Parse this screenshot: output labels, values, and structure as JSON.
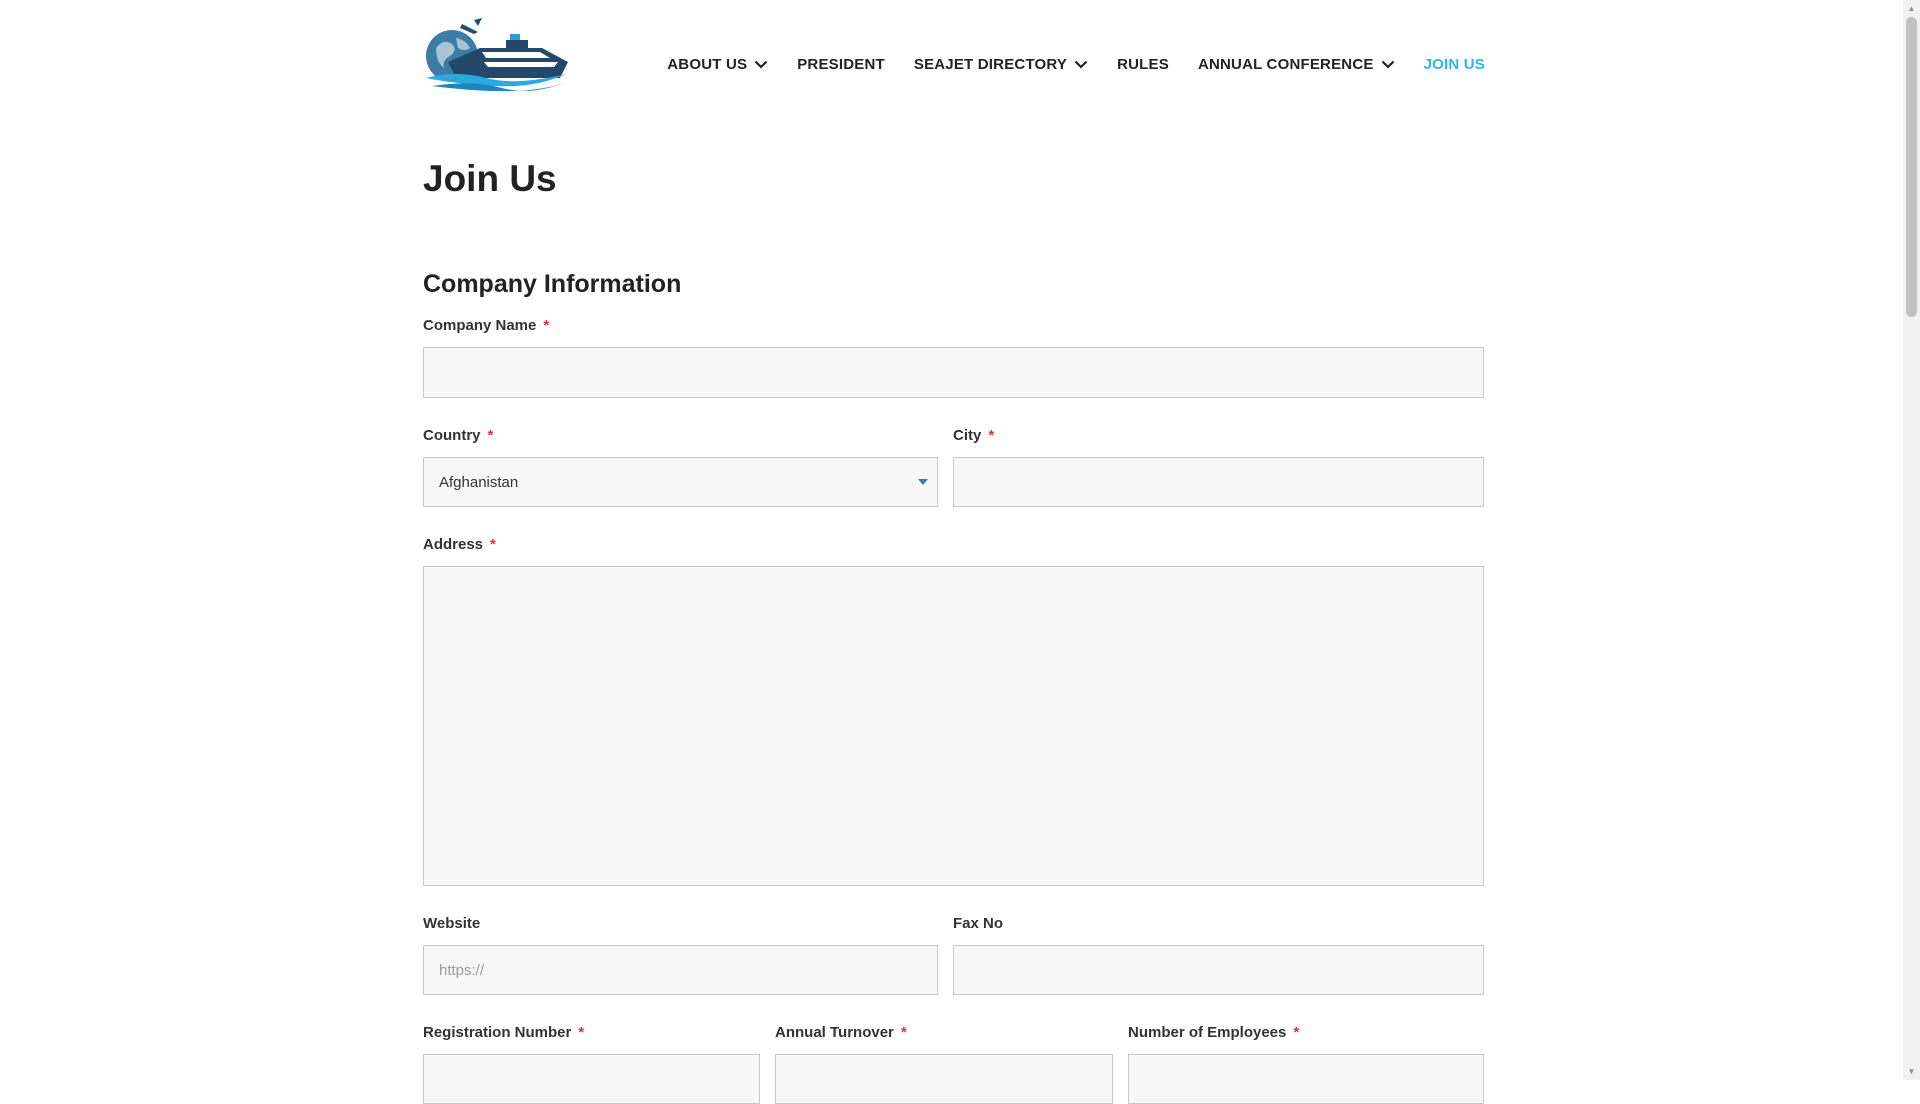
{
  "nav": {
    "items": [
      {
        "label": "ABOUT US",
        "has_dropdown": true,
        "active": false
      },
      {
        "label": "PRESIDENT",
        "has_dropdown": false,
        "active": false
      },
      {
        "label": "SEAJET DIRECTORY",
        "has_dropdown": true,
        "active": false
      },
      {
        "label": "RULES",
        "has_dropdown": false,
        "active": false
      },
      {
        "label": "ANNUAL CONFERENCE",
        "has_dropdown": true,
        "active": false
      },
      {
        "label": "JOIN US",
        "has_dropdown": false,
        "active": true
      }
    ],
    "active_color": "#2db8e0"
  },
  "page": {
    "title": "Join Us",
    "section_title": "Company Information"
  },
  "form": {
    "company_name": {
      "label": "Company Name",
      "required": true,
      "value": "",
      "placeholder": ""
    },
    "country": {
      "label": "Country",
      "required": true,
      "selected": "Afghanistan"
    },
    "city": {
      "label": "City",
      "required": true,
      "value": "",
      "placeholder": ""
    },
    "address": {
      "label": "Address",
      "required": true,
      "value": ""
    },
    "website": {
      "label": "Website",
      "required": false,
      "value": "",
      "placeholder": "https://"
    },
    "fax_no": {
      "label": "Fax No",
      "required": false,
      "value": "",
      "placeholder": ""
    },
    "registration_number": {
      "label": "Registration Number",
      "required": true,
      "value": ""
    },
    "annual_turnover": {
      "label": "Annual Turnover",
      "required": true,
      "value": ""
    },
    "number_of_employees": {
      "label": "Number of Employees",
      "required": true,
      "value": ""
    },
    "required_marker": "*"
  },
  "icons": {
    "logo": "ship-globe-logo",
    "dropdown": "chevron-down-icon",
    "select_caret": "caret-down-icon"
  }
}
